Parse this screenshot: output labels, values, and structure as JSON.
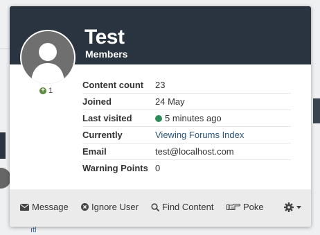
{
  "profile": {
    "username": "Test",
    "group": "Members",
    "reputation": "1",
    "fields": [
      {
        "label": "Content count",
        "value": "23"
      },
      {
        "label": "Joined",
        "value": "24 May"
      },
      {
        "label": "Last visited",
        "value": "5 minutes ago"
      },
      {
        "label": "Currently",
        "value": "Viewing Forums Index"
      },
      {
        "label": "Email",
        "value": "test@localhost.com"
      },
      {
        "label": "Warning Points",
        "value": "0"
      }
    ]
  },
  "actions": {
    "message": "Message",
    "ignore": "Ignore User",
    "find": "Find Content",
    "poke": "Poke"
  },
  "background": {
    "snippet": "ıtl"
  },
  "colors": {
    "header": "#2a3440",
    "link": "#2b557a",
    "online": "#2e8b57",
    "reputation": "#5a8a3a"
  }
}
